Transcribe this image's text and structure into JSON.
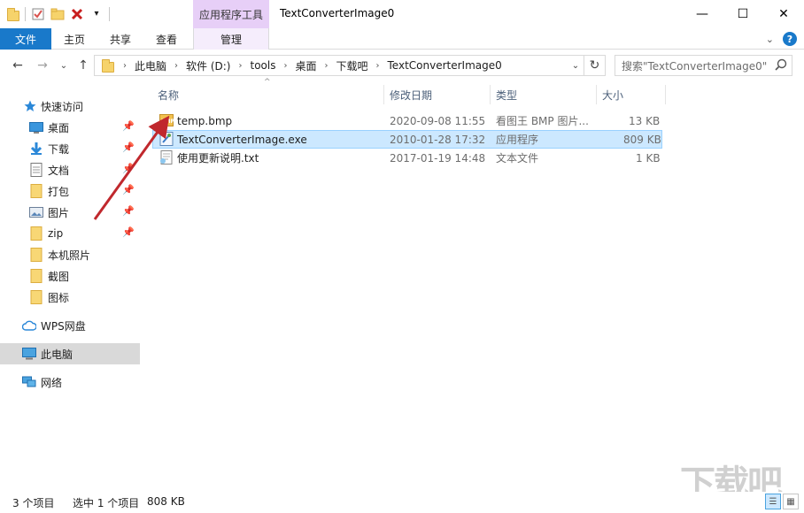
{
  "titlebar": {
    "contextual_tab": "应用程序工具",
    "window_title": "TextConverterImage0",
    "minimize": "—",
    "maximize": "☐",
    "close": "✕"
  },
  "ribbon": {
    "tabs": [
      "文件",
      "主页",
      "共享",
      "查看",
      "管理"
    ]
  },
  "address": {
    "crumbs": [
      "此电脑",
      "软件 (D:)",
      "tools",
      "桌面",
      "下载吧",
      "TextConverterImage0"
    ],
    "search_placeholder": "搜索\"TextConverterImage0\""
  },
  "sidebar": {
    "quick_access": "快速访问",
    "items": [
      {
        "label": "桌面",
        "icon": "desktop-icon",
        "pinned": true
      },
      {
        "label": "下载",
        "icon": "download-icon",
        "pinned": true
      },
      {
        "label": "文档",
        "icon": "document-icon",
        "pinned": true
      },
      {
        "label": "打包",
        "icon": "folder-icon",
        "pinned": true
      },
      {
        "label": "图片",
        "icon": "picture-icon",
        "pinned": true
      },
      {
        "label": "zip",
        "icon": "folder-icon",
        "pinned": true
      },
      {
        "label": "本机照片",
        "icon": "folder-icon",
        "pinned": false
      },
      {
        "label": "截图",
        "icon": "folder-icon",
        "pinned": false
      },
      {
        "label": "图标",
        "icon": "folder-icon",
        "pinned": false
      }
    ],
    "wps": "WPS网盘",
    "this_pc": "此电脑",
    "network": "网络"
  },
  "filelist": {
    "columns": [
      "名称",
      "修改日期",
      "类型",
      "大小"
    ],
    "rows": [
      {
        "name": "temp.bmp",
        "date": "2020-09-08 11:55",
        "type": "看图王 BMP 图片...",
        "size": "13 KB",
        "icon": "bmp-icon",
        "selected": false
      },
      {
        "name": "TextConverterImage.exe",
        "date": "2010-01-28 17:32",
        "type": "应用程序",
        "size": "809 KB",
        "icon": "exe-icon",
        "selected": true
      },
      {
        "name": "使用更新说明.txt",
        "date": "2017-01-19 14:48",
        "type": "文本文件",
        "size": "1 KB",
        "icon": "txt-icon",
        "selected": false
      }
    ]
  },
  "status": {
    "count": "3 个项目",
    "selected": "选中 1 个项目",
    "size": "808 KB"
  },
  "colors": {
    "accent": "#1979ca",
    "contextual": "#e7cff7",
    "selection": "#cce8ff",
    "annotation_arrow": "#c0282d"
  }
}
